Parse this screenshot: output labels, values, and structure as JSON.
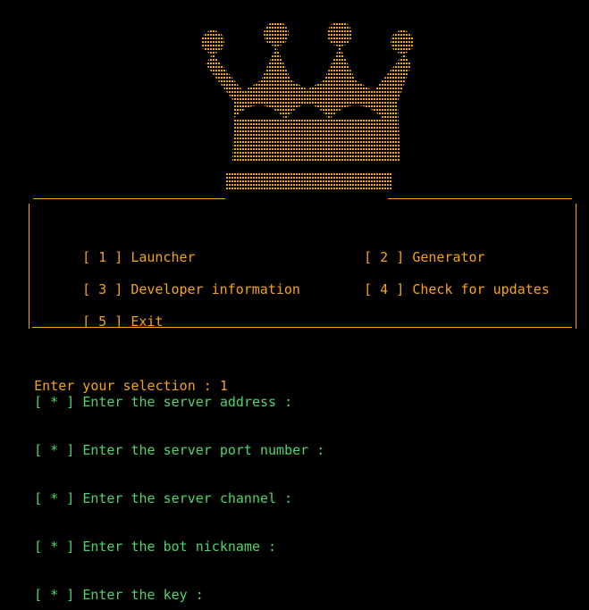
{
  "menu": {
    "items": [
      {
        "key": "[ 1 ]",
        "label": "Launcher"
      },
      {
        "key": "[ 2 ]",
        "label": "Generator"
      },
      {
        "key": "[ 3 ]",
        "label": "Developer information"
      },
      {
        "key": "[ 4 ]",
        "label": "Check for updates"
      },
      {
        "key": "[ 5 ]",
        "label": "Exit"
      }
    ]
  },
  "selection": {
    "prompt": "Enter your selection :",
    "value": "1"
  },
  "prompts": [
    {
      "marker": "[ * ]",
      "text": "Enter the server address :"
    },
    {
      "marker": "[ * ]",
      "text": "Enter the server port number :"
    },
    {
      "marker": "[ * ]",
      "text": "Enter the server channel :"
    },
    {
      "marker": "[ * ]",
      "text": "Enter the bot nickname :"
    },
    {
      "marker": "[ * ]",
      "text": "Enter the key :"
    }
  ],
  "colors": {
    "accent": "#f4a41c",
    "prompt": "#4fd36a",
    "background": "#000000"
  },
  "crown": {
    "icon": "crown-icon"
  }
}
